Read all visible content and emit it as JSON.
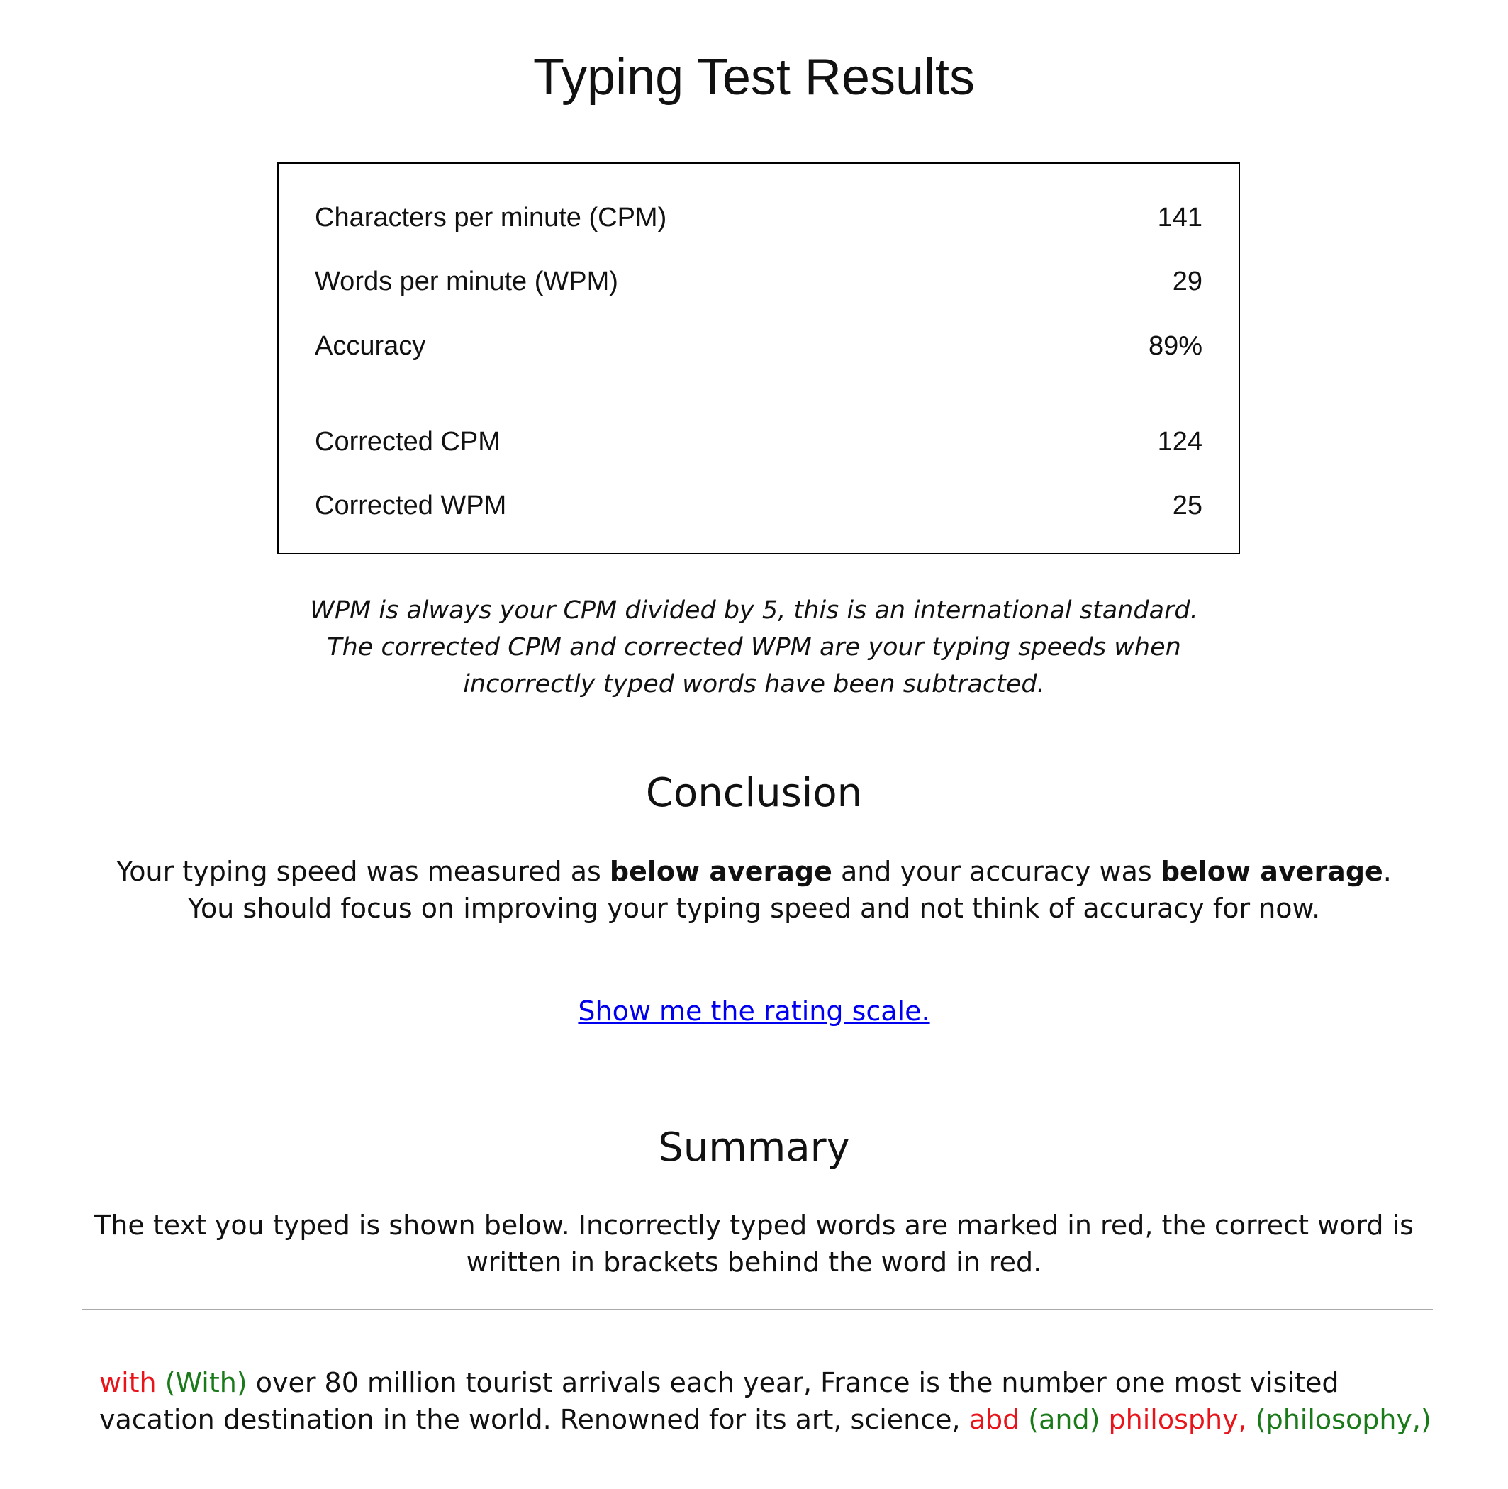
{
  "title": "Typing Test Results",
  "stats": {
    "cpm": {
      "label": "Characters per minute (CPM)",
      "value": "141"
    },
    "wpm": {
      "label": "Words per minute (WPM)",
      "value": "29"
    },
    "accuracy": {
      "label": "Accuracy",
      "value": "89%"
    },
    "corrected_cpm": {
      "label": "Corrected CPM",
      "value": "124"
    },
    "corrected_wpm": {
      "label": "Corrected WPM",
      "value": "25"
    }
  },
  "note": {
    "line1": "WPM is always your CPM divided by 5, this is an international standard.",
    "line2": "The corrected CPM and corrected WPM are your typing speeds when",
    "line3": "incorrectly typed words have been subtracted."
  },
  "conclusion": {
    "heading": "Conclusion",
    "line1_a": "Your typing speed was measured as ",
    "line1_b": "below average",
    "line1_c": " and your accuracy was ",
    "line1_d": "below average",
    "line1_e": ".",
    "line2": "You should focus on improving your typing speed and not think of accuracy for now.",
    "link": "Show me the rating scale."
  },
  "summary": {
    "heading": "Summary",
    "line1": "The text you typed is shown below. Incorrectly typed words are marked in red, the correct word is",
    "line2": "written in brackets behind the word in red."
  },
  "typed_text": {
    "w1_wrong": "with",
    "w1_right": " (With)",
    "seg1": " over 80 million tourist arrivals each year, France is the number one most visited",
    "seg2": "vacation destination in the world. Renowned for its art, science, ",
    "w2_wrong": "abd",
    "w2_right": " (and)",
    "w3_wrong": " philosphy,",
    "w3_right": " (philosophy,)"
  },
  "colors": {
    "wrong_word": "#e8141a",
    "correct_word": "#1a7a1a",
    "link": "#0000ee"
  }
}
